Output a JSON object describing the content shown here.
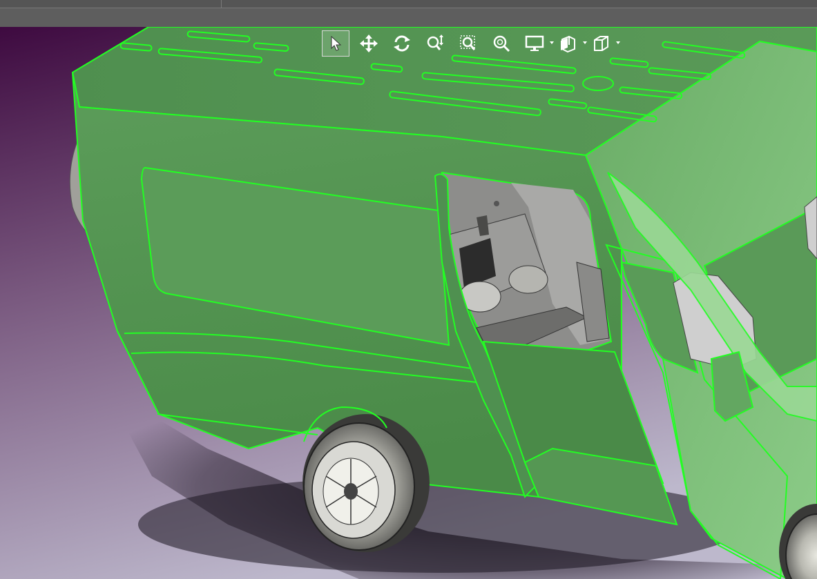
{
  "window": {
    "tabstrip": []
  },
  "viewer": {
    "background": {
      "top": "#3e0a40",
      "bottom": "#b8b4c8"
    },
    "highlight_color": "#22ff22",
    "body_fill": "#5ba05a",
    "selection": "van-body-highlighted"
  },
  "toolbar": {
    "buttons": [
      {
        "id": "select",
        "icon": "cursor-arrow-icon",
        "active": true,
        "has_menu": false
      },
      {
        "id": "pan",
        "icon": "pan-move-icon",
        "active": false,
        "has_menu": false
      },
      {
        "id": "rotate",
        "icon": "rotate-icon",
        "active": false,
        "has_menu": false
      },
      {
        "id": "zoom-in-out",
        "icon": "zoom-in-out-icon",
        "active": false,
        "has_menu": false
      },
      {
        "id": "zoom-area",
        "icon": "zoom-area-icon",
        "active": false,
        "has_menu": false
      },
      {
        "id": "zoom-fit",
        "icon": "zoom-fit-icon",
        "active": false,
        "has_menu": false
      },
      {
        "id": "display-mode",
        "icon": "monitor-display-icon",
        "active": false,
        "has_menu": true
      },
      {
        "id": "section-view",
        "icon": "section-view-icon",
        "active": false,
        "has_menu": true
      },
      {
        "id": "view-orientation",
        "icon": "cube-view-icon",
        "active": false,
        "has_menu": true
      }
    ]
  }
}
